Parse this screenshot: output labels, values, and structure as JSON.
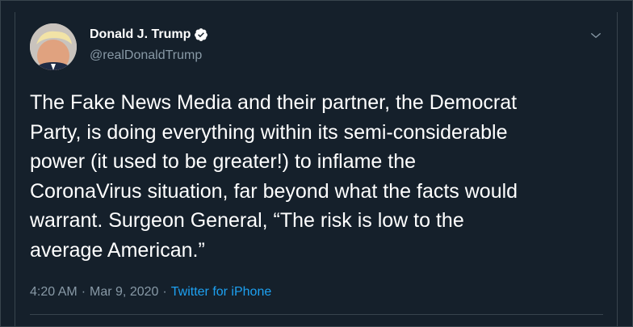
{
  "tweet": {
    "author": {
      "display_name": "Donald J. Trump",
      "handle": "@realDonaldTrump",
      "verified": true
    },
    "text": "The Fake News Media and their partner, the Democrat\nParty, is doing everything within its semi-considerable\npower (it used to be greater!) to inflame the\nCoronaVirus situation, far beyond what the facts would\nwarrant. Surgeon General, “The risk is low to the\naverage American.”",
    "time": "4:20 AM",
    "separator": "·",
    "date": "Mar 9, 2020",
    "source": "Twitter for iPhone"
  },
  "colors": {
    "background": "#15202b",
    "border": "#38444d",
    "text_primary": "#ffffff",
    "text_secondary": "#8899a6",
    "accent": "#1da1f2"
  },
  "icons": {
    "verified": "verified-badge-icon",
    "menu": "chevron-down-icon"
  }
}
